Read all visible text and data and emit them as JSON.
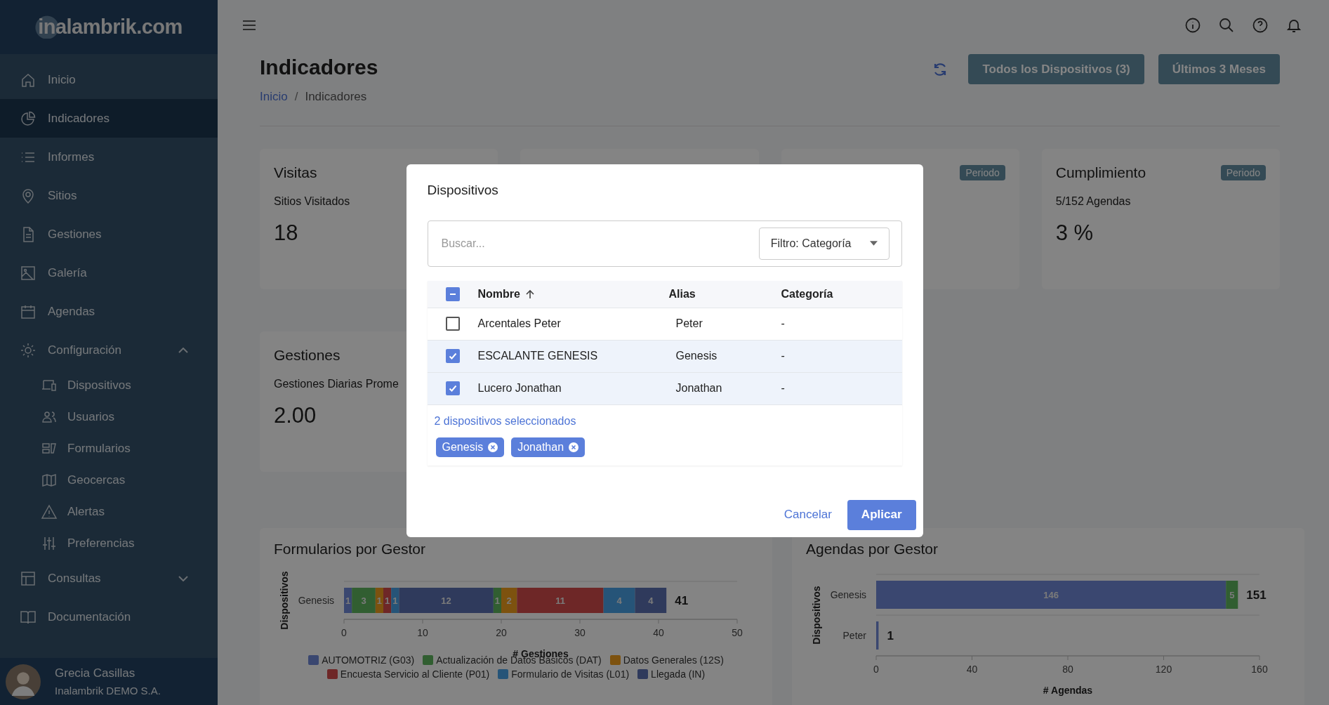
{
  "sidebar": {
    "logo": "inalambrik.com",
    "items": [
      {
        "label": "Inicio",
        "selected": false
      },
      {
        "label": "Indicadores",
        "selected": true
      },
      {
        "label": "Informes",
        "selected": false
      },
      {
        "label": "Sitios",
        "selected": false
      },
      {
        "label": "Gestiones",
        "selected": false
      },
      {
        "label": "Galería",
        "selected": false
      },
      {
        "label": "Agendas",
        "selected": false
      },
      {
        "label": "Configuración",
        "selected": false,
        "expanded": true,
        "children": [
          {
            "label": "Dispositivos"
          },
          {
            "label": "Usuarios"
          },
          {
            "label": "Formularios"
          },
          {
            "label": "Geocercas"
          },
          {
            "label": "Alertas"
          },
          {
            "label": "Preferencias"
          }
        ]
      },
      {
        "label": "Consultas",
        "selected": false,
        "expanded": false
      },
      {
        "label": "Documentación",
        "selected": false
      }
    ],
    "user": {
      "name": "Grecia Casillas",
      "company": "Inalambrik DEMO S.A."
    }
  },
  "page": {
    "title": "Indicadores",
    "separator": "/",
    "breadcrumb": [
      {
        "label": "Inicio",
        "link": true
      },
      {
        "label": "Indicadores",
        "link": false
      }
    ],
    "buttons": [
      "Todos los Dispositivos (3)",
      "Últimos 3 Meses"
    ]
  },
  "cards": [
    {
      "kind": "stat",
      "title": "Visitas",
      "subtitle": "Sitios Visitados",
      "value": "18"
    },
    {
      "kind": "covered"
    },
    {
      "kind": "stat",
      "badge": "Periodo"
    },
    {
      "kind": "stat",
      "title": "Cumplimiento",
      "badge": "Periodo",
      "subtitle": "5/152 Agendas",
      "value": "3 %"
    }
  ],
  "gestiones_card": {
    "title": "Gestiones",
    "subtitle": "Gestiones Diarias Prome",
    "value": "2.00"
  },
  "charts": [
    {
      "chart_data": {
        "type": "bar",
        "orientation": "horizontal",
        "stacked": true,
        "title": "Formularios por Gestor",
        "xlabel": "# Gestiones",
        "ylabel": "Dispositivos",
        "categories": [
          "Genesis"
        ],
        "xlim": [
          0,
          50
        ],
        "xticks": [
          0,
          10,
          20,
          30,
          40,
          50
        ],
        "data_labels": true,
        "annotations": [
          "41"
        ],
        "series": [
          {
            "name": "AUTOMOTRIZ (G03)",
            "color": "#7088d6",
            "values": [
              1
            ]
          },
          {
            "name": "Actualización de Datos Básicos (DAT)",
            "color": "#5fb55f",
            "values": [
              3
            ]
          },
          {
            "name": "Datos Generales (12S)",
            "color": "#ef9d1e",
            "values": [
              1
            ]
          },
          {
            "name": "Encuesta Servicio al Cliente (P01)",
            "color": "#d34c4c",
            "values": [
              1
            ]
          },
          {
            "name": "Formulario de Visitas (L01)",
            "color": "#4aa2e6",
            "values": [
              1
            ]
          },
          {
            "name": "Llegada (IN)",
            "color": "#5a6fb0",
            "values": [
              12
            ]
          },
          {
            "color": "#5fb55f",
            "values": [
              1
            ]
          },
          {
            "color": "#ef9d1e",
            "values": [
              2
            ]
          },
          {
            "color": "#d34c4c",
            "values": [
              11
            ]
          },
          {
            "color": "#4aa2e6",
            "values": [
              4
            ]
          },
          {
            "color": "#5a6fb0",
            "values": [
              4
            ]
          }
        ]
      }
    },
    {
      "chart_data": {
        "type": "bar",
        "orientation": "horizontal",
        "stacked": true,
        "title": "Agendas por Gestor",
        "xlabel": "# Agendas",
        "ylabel": "Dispositivos",
        "categories": [
          "Genesis",
          "Peter"
        ],
        "xlim": [
          0,
          160
        ],
        "xticks": [
          0,
          40,
          80,
          120,
          160
        ],
        "annotations": [
          "151",
          "1"
        ],
        "series": [
          {
            "color": "#7088d6",
            "values": [
              146,
              1
            ],
            "value_labels": [
              "146",
              null
            ]
          },
          {
            "color": "#5fb55f",
            "values": [
              5,
              null
            ],
            "value_labels": [
              "5",
              null
            ]
          }
        ]
      }
    }
  ],
  "dialog": {
    "title": "Dispositivos",
    "search": {
      "placeholder": "Buscar..."
    },
    "filter": "Filtro: Categoría",
    "header_checkbox": {
      "indeterminate": true
    },
    "columns": [
      {
        "label": "Nombre",
        "sorted": true
      },
      {
        "label": "Alias",
        "sorted": false
      },
      {
        "label": "Categoría",
        "sorted": false
      }
    ],
    "rows": [
      {
        "name": "Arcentales Peter",
        "alias": "Peter",
        "category": "-",
        "checked": false
      },
      {
        "name": "ESCALANTE GENESIS",
        "alias": "Genesis",
        "category": "-",
        "checked": true
      },
      {
        "name": "Lucero Jonathan",
        "alias": "Jonathan",
        "category": "-",
        "checked": true
      }
    ],
    "summary": "2 dispositivos seleccionados",
    "chips": [
      "Genesis",
      "Jonathan"
    ],
    "cancel": "Cancelar",
    "apply": "Aplicar"
  }
}
